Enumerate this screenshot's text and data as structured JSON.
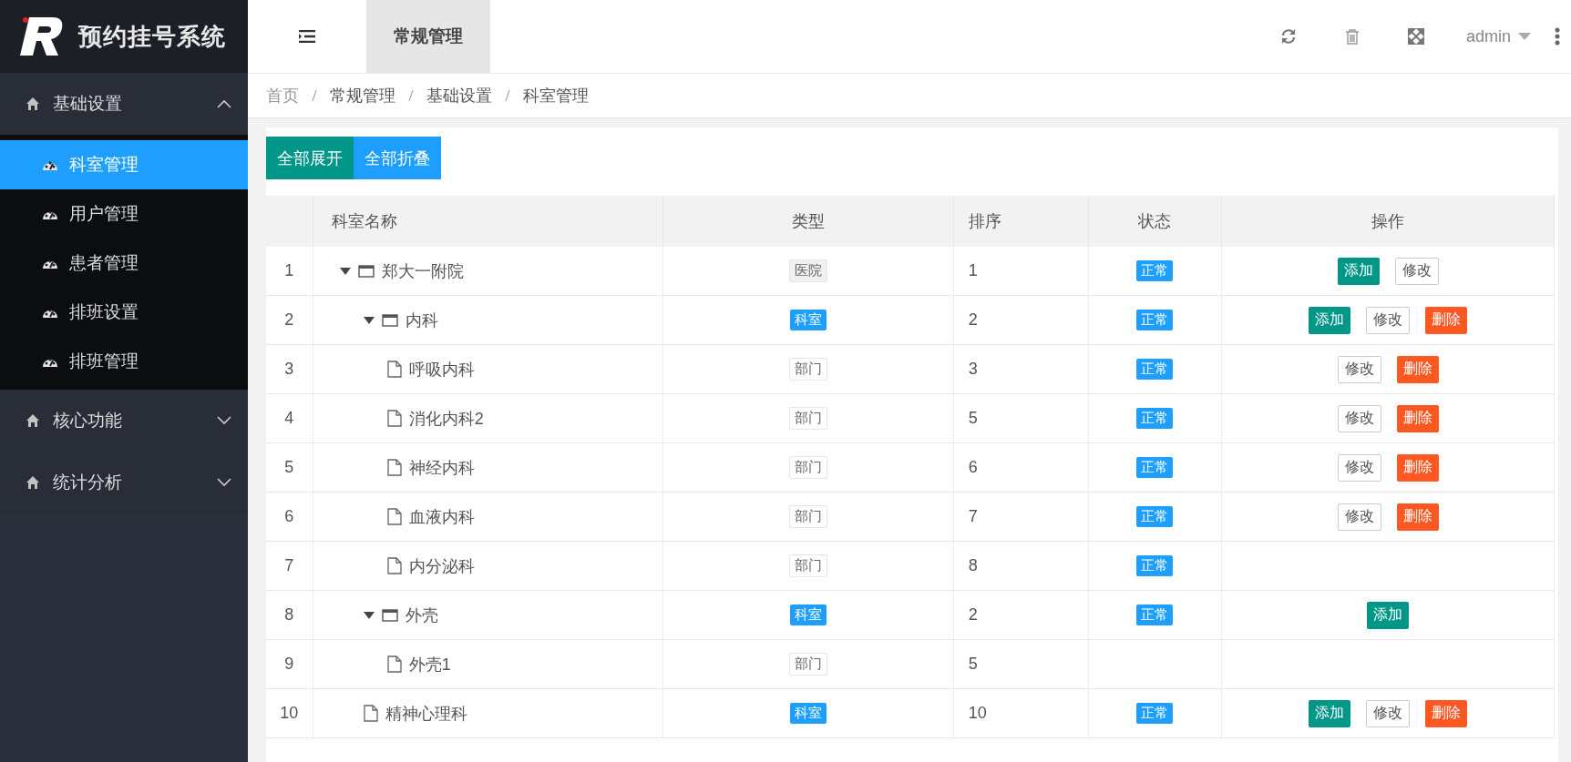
{
  "app": {
    "title": "预约挂号系统"
  },
  "sidebar": {
    "groups": [
      {
        "label": "基础设置",
        "expanded": true,
        "items": [
          {
            "label": "科室管理",
            "selected": true
          },
          {
            "label": "用户管理",
            "selected": false
          },
          {
            "label": "患者管理",
            "selected": false
          },
          {
            "label": "排班设置",
            "selected": false
          },
          {
            "label": "排班管理",
            "selected": false
          }
        ]
      },
      {
        "label": "核心功能",
        "expanded": false
      },
      {
        "label": "统计分析",
        "expanded": false
      }
    ]
  },
  "header": {
    "tabs": [
      {
        "label": "常规管理",
        "selected": true
      }
    ],
    "user": "admin"
  },
  "breadcrumb": [
    "首页",
    "常规管理",
    "基础设置",
    "科室管理"
  ],
  "toolbar": [
    {
      "label": "全部展开",
      "kind": "expand"
    },
    {
      "label": "全部折叠",
      "kind": "collapse"
    }
  ],
  "table": {
    "columns": [
      "科室名称",
      "类型",
      "排序",
      "状态",
      "操作"
    ],
    "rows": [
      {
        "index": "1",
        "name": "郑大一附院",
        "expanded": true,
        "type": {
          "label": "医院",
          "kind": "hospital"
        },
        "order": "1",
        "status": "正常",
        "ops": [
          {
            "label": "添加",
            "kind": "add"
          },
          {
            "label": "修改",
            "kind": "edit"
          }
        ],
        "children": [
          {
            "index": "2",
            "name": "内科",
            "expanded": true,
            "type": {
              "label": "科室",
              "kind": "room"
            },
            "order": "2",
            "status": "正常",
            "ops": [
              {
                "label": "添加",
                "kind": "add"
              },
              {
                "label": "修改",
                "kind": "edit"
              },
              {
                "label": "删除",
                "kind": "delete"
              }
            ],
            "children": [
              {
                "index": "3",
                "name": "呼吸内科",
                "type": {
                  "label": "部门",
                  "kind": "dept"
                },
                "order": "3",
                "status": "正常",
                "ops": [
                  {
                    "label": "修改",
                    "kind": "edit"
                  },
                  {
                    "label": "删除",
                    "kind": "delete"
                  }
                ]
              },
              {
                "index": "4",
                "name": "消化内科2",
                "type": {
                  "label": "部门",
                  "kind": "dept"
                },
                "order": "5",
                "status": "正常",
                "ops": [
                  {
                    "label": "修改",
                    "kind": "edit"
                  },
                  {
                    "label": "删除",
                    "kind": "delete"
                  }
                ]
              },
              {
                "index": "5",
                "name": "神经内科",
                "type": {
                  "label": "部门",
                  "kind": "dept"
                },
                "order": "6",
                "status": "正常",
                "ops": [
                  {
                    "label": "修改",
                    "kind": "edit"
                  },
                  {
                    "label": "删除",
                    "kind": "delete"
                  }
                ]
              },
              {
                "index": "6",
                "name": "血液内科",
                "type": {
                  "label": "部门",
                  "kind": "dept"
                },
                "order": "7",
                "status": "正常",
                "ops": [
                  {
                    "label": "修改",
                    "kind": "edit"
                  },
                  {
                    "label": "删除",
                    "kind": "delete"
                  }
                ]
              },
              {
                "index": "7",
                "name": "内分泌科",
                "type": {
                  "label": "部门",
                  "kind": "dept"
                },
                "order": "8",
                "status": "正常"
              }
            ]
          },
          {
            "index": "8",
            "name": "外壳",
            "expanded": true,
            "type": {
              "label": "科室",
              "kind": "room"
            },
            "order": "2",
            "status": "正常",
            "ops": [
              {
                "label": "添加",
                "kind": "add"
              }
            ],
            "children": [
              {
                "index": "9",
                "name": "外壳1",
                "type": {
                  "label": "部门",
                  "kind": "dept"
                },
                "order": "5"
              }
            ]
          },
          {
            "index": "10",
            "name": "精神心理科",
            "type": {
              "label": "科室",
              "kind": "room"
            },
            "order": "10",
            "status": "正常",
            "ops": [
              {
                "label": "添加",
                "kind": "add"
              },
              {
                "label": "修改",
                "kind": "edit"
              },
              {
                "label": "删除",
                "kind": "delete"
              }
            ]
          }
        ]
      }
    ]
  }
}
